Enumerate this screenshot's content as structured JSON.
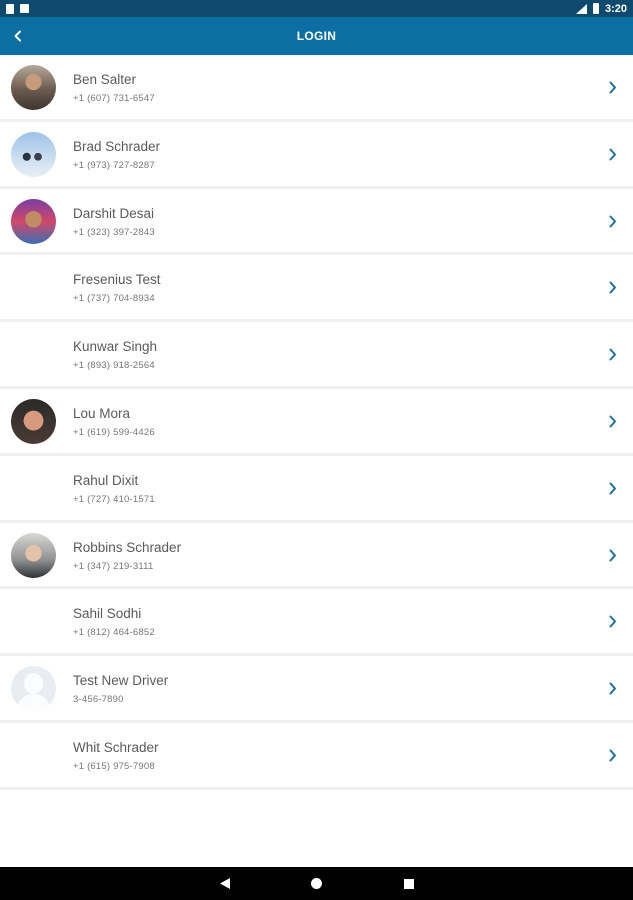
{
  "status_bar": {
    "time": "3:20"
  },
  "app_bar": {
    "title": "LOGIN"
  },
  "colors": {
    "status_bar": "#0d4a6e",
    "app_bar": "#0c6ea3",
    "chevron": "#1f6f9f"
  },
  "contacts": [
    {
      "name": "Ben Salter",
      "phone": "+1 (607) 731-6547",
      "avatar": "photo"
    },
    {
      "name": "Brad Schrader",
      "phone": "+1 (973) 727-8287",
      "avatar": "photo"
    },
    {
      "name": "Darshit Desai",
      "phone": "+1 (323) 397-2843",
      "avatar": "photo"
    },
    {
      "name": "Fresenius Test",
      "phone": "+1 (737) 704-8934",
      "avatar": "none"
    },
    {
      "name": "Kunwar Singh",
      "phone": "+1 (893) 918-2564",
      "avatar": "none"
    },
    {
      "name": "Lou Mora",
      "phone": "+1 (619) 599-4426",
      "avatar": "photo"
    },
    {
      "name": "Rahul Dixit",
      "phone": "+1 (727) 410-1571",
      "avatar": "none"
    },
    {
      "name": "Robbins Schrader",
      "phone": "+1 (347) 219-3111",
      "avatar": "photo"
    },
    {
      "name": "Sahil Sodhi",
      "phone": "+1 (812) 464-6852",
      "avatar": "none"
    },
    {
      "name": "Test New Driver",
      "phone": "3-456-7890",
      "avatar": "placeholder"
    },
    {
      "name": "Whit Schrader",
      "phone": "+1 (615) 975-7908",
      "avatar": "none"
    }
  ],
  "nav_bar": {
    "buttons": [
      "back-icon",
      "home-icon",
      "recents-icon"
    ]
  }
}
